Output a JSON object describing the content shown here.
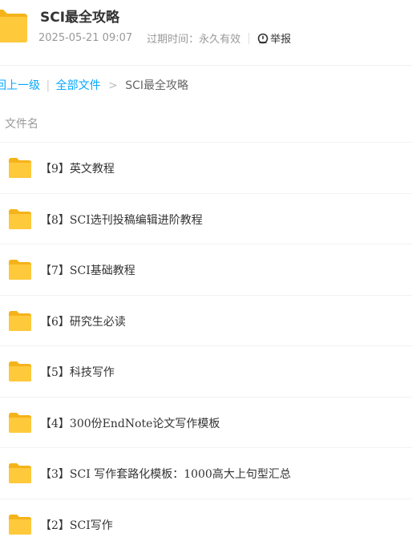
{
  "header": {
    "title": "SCI最全攻略",
    "date": "2025-05-21 09:07",
    "expire": "过期时间：永久有效",
    "report_label": "举报",
    "icon": "folder-icon"
  },
  "breadcrumb": {
    "back_label": "回上一级",
    "divider": "|",
    "all_files_label": "全部文件",
    "arrow": ">",
    "current": "SCI最全攻略"
  },
  "columns": {
    "name_header": "文件名"
  },
  "files": [
    {
      "name": "【9】英文教程",
      "icon": "folder-icon"
    },
    {
      "name": "【8】SCI选刊投稿编辑进阶教程",
      "icon": "folder-icon"
    },
    {
      "name": "【7】SCI基础教程",
      "icon": "folder-icon"
    },
    {
      "name": "【6】研究生必读",
      "icon": "folder-icon"
    },
    {
      "name": "【5】科技写作",
      "icon": "folder-icon"
    },
    {
      "name": "【4】300份EndNote论文写作模板",
      "icon": "folder-icon"
    },
    {
      "name": "【3】SCI 写作套路化模板：1000高大上句型汇总",
      "icon": "folder-icon"
    },
    {
      "name": "【2】SCI写作",
      "icon": "folder-icon"
    }
  ],
  "colors": {
    "folder_body": "#ffc93c",
    "folder_tab": "#f5b31a",
    "link": "#06a7ff"
  }
}
